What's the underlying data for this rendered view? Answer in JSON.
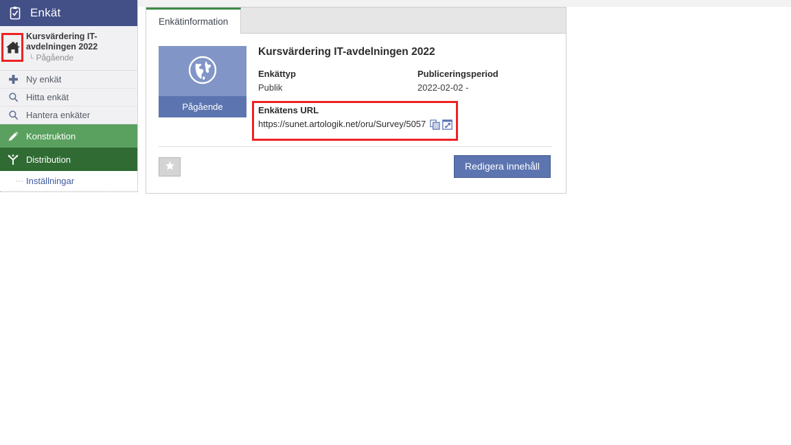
{
  "sidebar": {
    "header": {
      "title": "Enkät",
      "icon": "clipboard-check-icon"
    },
    "survey": {
      "home_icon": "home-icon",
      "name": "Kursvärdering IT-avdelningen 2022",
      "sub_prefix": "L",
      "sub_status": "Pågående"
    },
    "items": [
      {
        "label": "Ny enkät",
        "icon": "plus-icon"
      },
      {
        "label": "Hitta enkät",
        "icon": "search-icon"
      },
      {
        "label": "Hantera enkäter",
        "icon": "search-icon"
      }
    ],
    "sections": [
      {
        "label": "Konstruktion",
        "icon": "pencil-icon",
        "color": "#5aa05f"
      },
      {
        "label": "Distribution",
        "icon": "distribution-branch-icon",
        "color": "#2f6b33"
      }
    ],
    "sub_items": [
      {
        "label": "Inställningar"
      }
    ]
  },
  "panel": {
    "tabs": [
      {
        "label": "Enkätinformation",
        "active": true
      }
    ],
    "status_card": {
      "icon": "globe-icon",
      "label": "Pågående"
    },
    "survey_title": "Kursvärdering IT-avdelningen 2022",
    "meta": [
      {
        "label": "Enkättyp",
        "value": "Publik"
      },
      {
        "label": "Publiceringsperiod",
        "value": "2022-02-02 -"
      }
    ],
    "url": {
      "label": "Enkätens URL",
      "value": "https://sunet.artologik.net/oru/Survey/5057",
      "copy_icon": "copy-icon",
      "open_icon": "open-in-new-window-icon"
    },
    "footer": {
      "favorite_label": "★",
      "favorite_icon": "star-icon",
      "primary_label": "Redigera innehåll"
    }
  },
  "annotations": [
    {
      "name": "home-highlight",
      "color": "#ef2020"
    },
    {
      "name": "url-highlight",
      "color": "#ef2020"
    }
  ]
}
